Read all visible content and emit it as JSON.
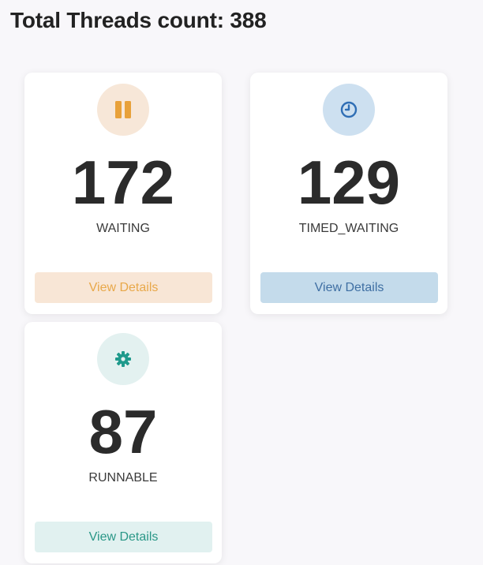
{
  "header": {
    "title": "Total Threads count: 388"
  },
  "cards": [
    {
      "count": "172",
      "state": "WAITING",
      "button": "View Details",
      "icon": "pause-icon",
      "icon_bg": "#f7e7d8",
      "icon_color": "#e8a13a",
      "button_bg": "#f8e6d6",
      "button_color": "#e8a84a"
    },
    {
      "count": "129",
      "state": "TIMED_WAITING",
      "button": "View Details",
      "icon": "clock-icon",
      "icon_bg": "#cde0f0",
      "icon_color": "#2f6eb5",
      "button_bg": "#c4dbeb",
      "button_color": "#3f6fa3"
    },
    {
      "count": "87",
      "state": "RUNNABLE",
      "button": "View Details",
      "icon": "gear-icon",
      "icon_bg": "#e3f1f0",
      "icon_color": "#1f9a8c",
      "button_bg": "#e1f1f0",
      "button_color": "#2a9787"
    }
  ]
}
